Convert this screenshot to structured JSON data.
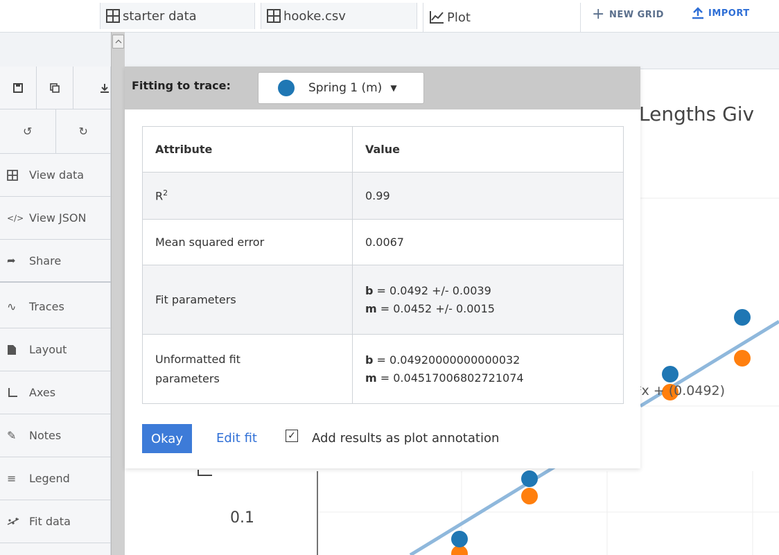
{
  "tabs": [
    {
      "label": "starter data",
      "icon": "grid-icon"
    },
    {
      "label": "hooke.csv",
      "icon": "grid-icon"
    },
    {
      "label": "Plot",
      "icon": "line-chart-icon"
    }
  ],
  "top_actions": {
    "new_grid": "NEW GRID",
    "import": "IMPORT"
  },
  "sidebar": {
    "tools_row1": [
      "save-icon",
      "copy-icon",
      "download-icon"
    ],
    "tools_row2": [
      "undo-icon",
      "redo-icon"
    ],
    "items": [
      {
        "label": "View data",
        "icon": "grid-icon"
      },
      {
        "label": "View JSON",
        "icon": "code-icon"
      },
      {
        "label": "Share",
        "icon": "share-icon"
      },
      {
        "label": "Traces",
        "icon": "trace-icon"
      },
      {
        "label": "Layout",
        "icon": "layout-icon"
      },
      {
        "label": "Axes",
        "icon": "axes-icon"
      },
      {
        "label": "Notes",
        "icon": "pencil-icon"
      },
      {
        "label": "Legend",
        "icon": "legend-icon"
      },
      {
        "label": "Fit data",
        "icon": "fit-icon"
      }
    ]
  },
  "plot": {
    "title_partial": "Lengths Giv",
    "annotation_partial": "*x + (0.0492)",
    "tick_label": "0.1"
  },
  "modal": {
    "fitting_label": "Fitting to trace:",
    "selected_trace": "Spring 1 (m)",
    "table": {
      "headers": [
        "Attribute",
        "Value"
      ],
      "r2_label": "R",
      "r2_sup": "2",
      "r2_value": "0.99",
      "mse_label": "Mean squared error",
      "mse_value": "0.0067",
      "fit_label": "Fit parameters",
      "fit_b_name": "b",
      "fit_b_value": " = 0.0492 +/- 0.0039",
      "fit_m_name": "m",
      "fit_m_value": " = 0.0452 +/- 0.0015",
      "unf_label": "Unformatted fit parameters",
      "unf_b_name": "b",
      "unf_b_value": " = 0.04920000000000032",
      "unf_m_name": "m",
      "unf_m_value": " = 0.04517006802721074"
    },
    "okay_label": "Okay",
    "edit_fit_label": "Edit fit",
    "annotation_checkbox_label": "Add results as plot annotation",
    "annotation_checked": true
  },
  "colors": {
    "series1": "#1f77b4",
    "series2": "#ff7f0e",
    "fitline": "#8fb8dc",
    "accent": "#3d7bd8"
  }
}
